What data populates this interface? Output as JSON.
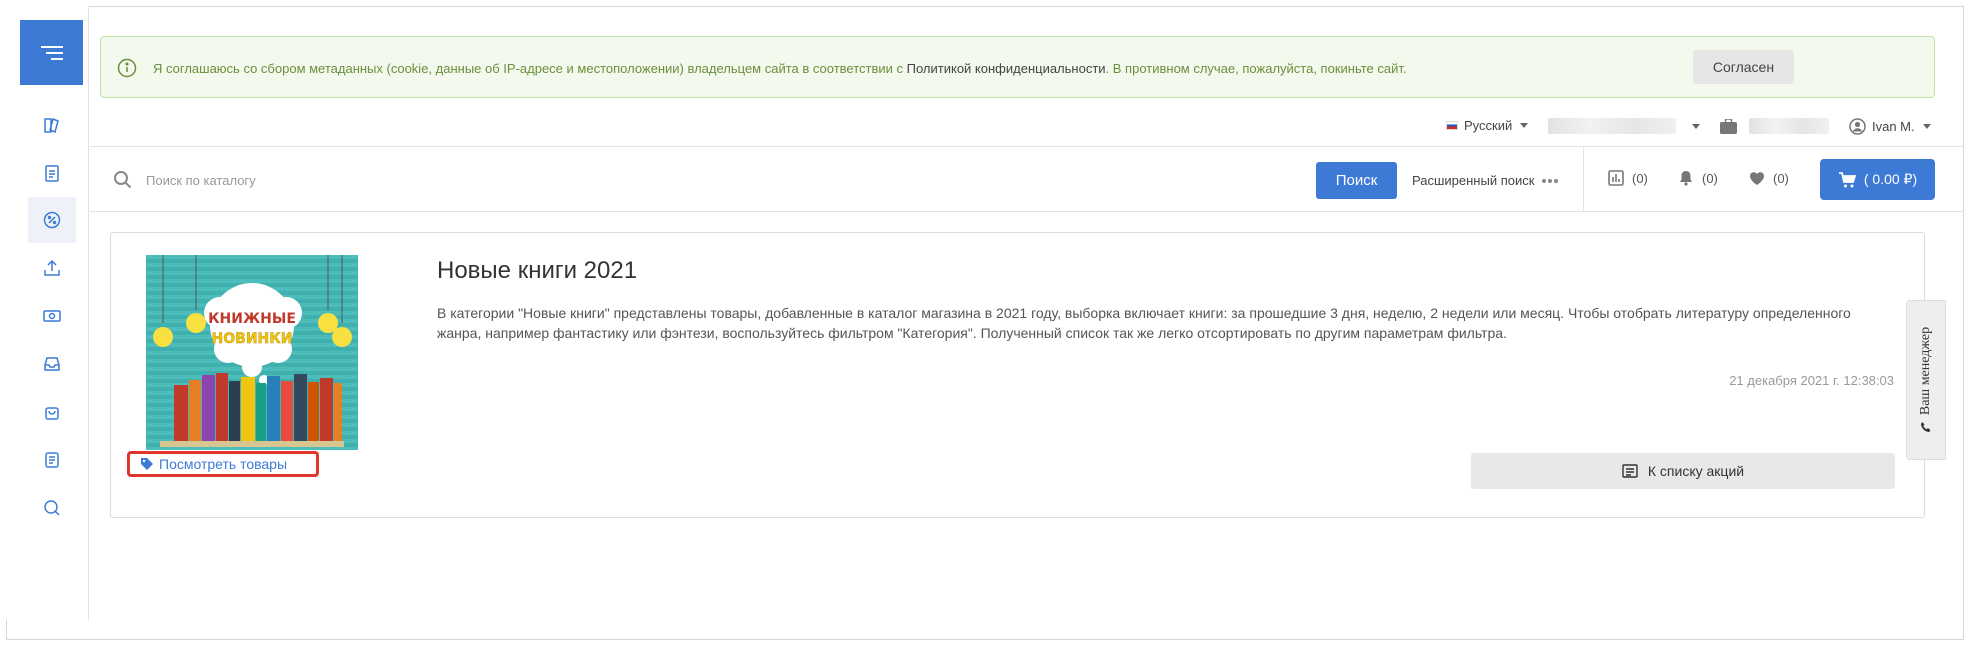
{
  "cookie": {
    "text_before": "Я соглашаюсь со сбором метаданных (cookie, данные об IP-адресе и местоположении) владельцем сайта в соответствии с ",
    "link": "Политикой конфиденциальности",
    "text_after": ". В противном случае, пожалуйста, покиньте сайт.",
    "accept_label": "Согласен"
  },
  "topbar": {
    "language": "Русский",
    "user": "Ivan M."
  },
  "search": {
    "placeholder": "Поиск по каталогу",
    "button_label": "Поиск",
    "advanced_label": "Расширенный поиск"
  },
  "counters": {
    "compare": "(0)",
    "notifications": "(0)",
    "favorites": "(0)",
    "cart": "( 0.00 ₽)"
  },
  "promo": {
    "title": "Новые книги 2021",
    "description": "В категории \"Новые книги\" представлены товары, добавленные в каталог магазина в 2021 году, выборка включает книги: за прошедшие 3 дня, неделю, 2 недели или месяц. Чтобы отобрать литературу определенного жанра, например фантастику или фэнтези, воспользуйтесь фильтром \"Категория\". Полученный список так же легко отсортировать по другим параметрам фильтра.",
    "date": "21 декабря 2021 г. 12:38:03",
    "view_products_label": "Посмотреть товары",
    "back_label": "К списку акций",
    "image_line1": "КНИЖНЫЕ",
    "image_line2": "НОВИНКИ"
  },
  "manager_tab": {
    "label": "Ваш менеджер"
  },
  "colors": {
    "accent": "#3d7ad6",
    "cookie_bg": "#f3f9ec",
    "cookie_border": "#bfe3a3",
    "highlight": "#e0352b"
  },
  "sidebar": {
    "icons": [
      "menu-icon",
      "catalog-icon",
      "orders-icon",
      "discount-icon",
      "upload-icon",
      "payment-icon",
      "inbox-icon",
      "bag-icon",
      "document-icon",
      "chat-icon"
    ]
  }
}
